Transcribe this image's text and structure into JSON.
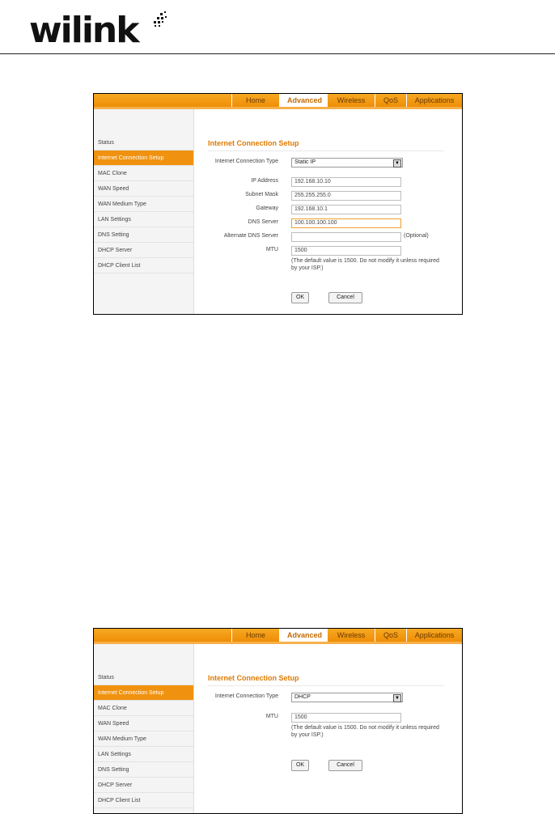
{
  "document": {
    "brand": "wilink",
    "brand_mark": "™"
  },
  "screenshots": [
    {
      "nav": [
        "Home",
        "Advanced",
        "Wireless",
        "QoS",
        "Applications"
      ],
      "active_tab": "Advanced",
      "sidebar": [
        "Status",
        "Internet Connection Setup",
        "MAC Clone",
        "WAN Speed",
        "WAN Medium Type",
        "LAN Settings",
        "DNS Setting",
        "DHCP Server",
        "DHCP Client List"
      ],
      "active_sidebar": "Internet Connection Setup",
      "section_title": "Internet Connection Setup",
      "connection_type_label": "Internet Connection Type",
      "connection_type_value": "Static IP",
      "fields": [
        {
          "label": "IP Address",
          "value": "192.168.10.10"
        },
        {
          "label": "Subnet Mask",
          "value": "255.255.255.0"
        },
        {
          "label": "Gateway",
          "value": "192.168.10.1"
        },
        {
          "label": "DNS Server",
          "value": "100.100.100.100"
        },
        {
          "label": "Alternate DNS Server",
          "value": "",
          "suffix": "(Optional)"
        },
        {
          "label": "MTU",
          "value": "1500"
        }
      ],
      "mtu_hint": "(The default value is 1500. Do not modify it unless required by your ISP.)",
      "ok_label": "OK",
      "cancel_label": "Cancel"
    },
    {
      "nav": [
        "Home",
        "Advanced",
        "Wireless",
        "QoS",
        "Applications"
      ],
      "active_tab": "Advanced",
      "sidebar": [
        "Status",
        "Internet Connection Setup",
        "MAC Clone",
        "WAN Speed",
        "WAN Medium Type",
        "LAN Settings",
        "DNS Setting",
        "DHCP Server",
        "DHCP Client List"
      ],
      "active_sidebar": "Internet Connection Setup",
      "section_title": "Internet Connection Setup",
      "connection_type_label": "Internet Connection Type",
      "connection_type_value": "DHCP",
      "fields": [
        {
          "label": "MTU",
          "value": "1500"
        }
      ],
      "mtu_hint": "(The default value is 1500. Do not modify it unless required by your ISP.)",
      "ok_label": "OK",
      "cancel_label": "Cancel"
    }
  ]
}
